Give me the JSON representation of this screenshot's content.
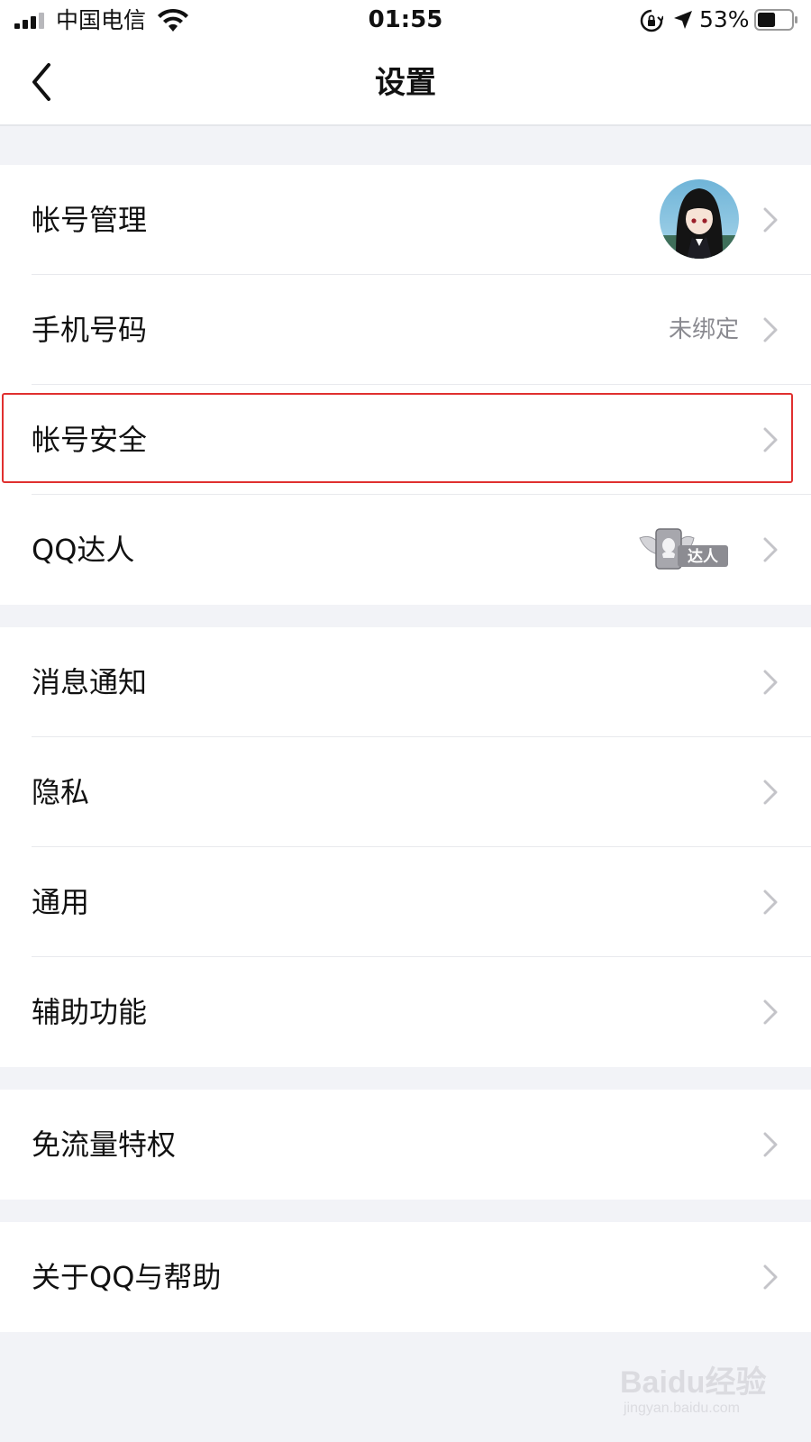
{
  "status_bar": {
    "carrier": "中国电信",
    "time": "01:55",
    "battery_percent": "53%",
    "battery_level": 0.53,
    "icons": [
      "signal-icon",
      "wifi-icon",
      "orientation-lock-icon",
      "location-icon",
      "battery-icon"
    ]
  },
  "nav": {
    "title": "设置",
    "back_icon": "chevron-left-icon"
  },
  "groups": [
    {
      "items": [
        {
          "label": "帐号管理",
          "accessory": "avatar"
        },
        {
          "label": "手机号码",
          "value": "未绑定"
        },
        {
          "label": "帐号安全",
          "highlighted": true
        },
        {
          "label": "QQ达人",
          "accessory": "badge",
          "badge_text": "达人"
        }
      ]
    },
    {
      "items": [
        {
          "label": "消息通知"
        },
        {
          "label": "隐私"
        },
        {
          "label": "通用"
        },
        {
          "label": "辅助功能"
        }
      ]
    },
    {
      "items": [
        {
          "label": "免流量特权"
        }
      ]
    },
    {
      "items": [
        {
          "label": "关于QQ与帮助"
        }
      ]
    }
  ],
  "watermark": {
    "brand": "Baidu经验",
    "url": "jingyan.baidu.com"
  },
  "colors": {
    "background": "#f2f3f7",
    "highlight": "#e0302f",
    "secondary_text": "#8a8a90",
    "chevron": "#c4c4c9"
  }
}
